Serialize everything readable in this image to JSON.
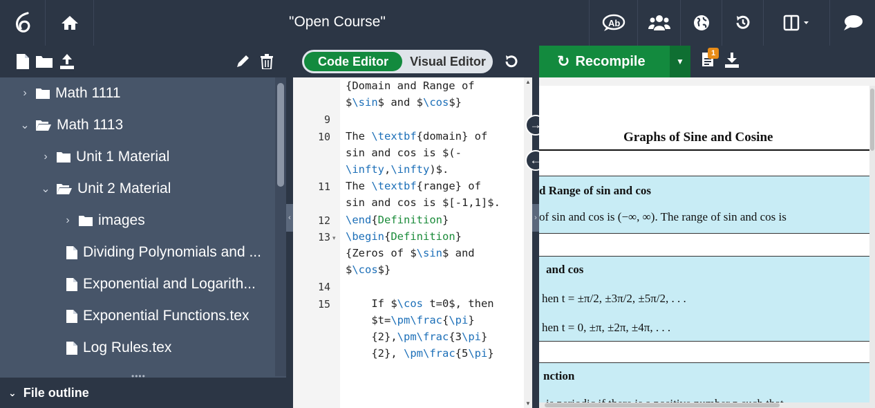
{
  "header": {
    "project_title": "\"Open Course\""
  },
  "icons": {
    "logo": "overleaf-logo-icon",
    "home": "home-icon",
    "review": "review-icon",
    "share": "share-icon",
    "publish": "globe-icon",
    "history": "history-icon",
    "layout": "layout-icon",
    "chat": "chat-icon"
  },
  "file_tree": {
    "items": [
      {
        "label": "Math 1111",
        "type": "folder",
        "expanded": false
      },
      {
        "label": "Math 1113",
        "type": "folder",
        "expanded": true
      },
      {
        "label": "Unit 1 Material",
        "type": "folder",
        "expanded": false
      },
      {
        "label": "Unit 2 Material",
        "type": "folder",
        "expanded": true
      },
      {
        "label": "images",
        "type": "folder",
        "expanded": false
      },
      {
        "label": "Dividing Polynomials and ...",
        "type": "file"
      },
      {
        "label": "Exponential and Logarith...",
        "type": "file"
      },
      {
        "label": "Exponential Functions.tex",
        "type": "file"
      },
      {
        "label": "Log Rules.tex",
        "type": "file"
      }
    ],
    "outline_label": "File outline"
  },
  "editor_toolbar": {
    "code_editor_label": "Code Editor",
    "visual_editor_label": "Visual Editor",
    "recompile_label": "Recompile",
    "logs_badge": "1"
  },
  "code": {
    "lines": [
      {
        "num": "",
        "text": "{Domain and Range of"
      },
      {
        "num": "",
        "text": "$\\sin$ and $\\cos$}"
      },
      {
        "num": "9",
        "text": ""
      },
      {
        "num": "10",
        "text": "The \\textbf{domain} of"
      },
      {
        "num": "",
        "text": "sin and cos is $(-"
      },
      {
        "num": "",
        "text": "\\infty,\\infty)$."
      },
      {
        "num": "11",
        "text": "The \\textbf{range} of"
      },
      {
        "num": "",
        "text": "sin and cos is $[-1,1]$."
      },
      {
        "num": "12",
        "text": "\\end{Definition}"
      },
      {
        "num": "13",
        "text": "\\begin{Definition}"
      },
      {
        "num": "",
        "text": "{Zeros of $\\sin$ and"
      },
      {
        "num": "",
        "text": "$\\cos$}"
      },
      {
        "num": "14",
        "text": ""
      },
      {
        "num": "15",
        "text": "    If $\\cos t=0$, then"
      },
      {
        "num": "",
        "text": "    $t=\\pm\\frac{\\pi}"
      },
      {
        "num": "",
        "text": "    {2},\\pm\\frac{3\\pi}"
      },
      {
        "num": "",
        "text": "    {2}, \\pm\\frac{5\\pi}"
      }
    ]
  },
  "pdf": {
    "title": "Graphs of Sine and Cosine",
    "lines": [
      "d Range of sin and cos",
      "of sin and cos is (−∞, ∞). The range of sin and cos is",
      "and cos",
      "hen t = ±π/2, ±3π/2, ±5π/2, . . .",
      "hen t = 0, ±π, ±2π, ±4π, . . .",
      "nction",
      "is periodic if there is a positive number p such that"
    ]
  }
}
